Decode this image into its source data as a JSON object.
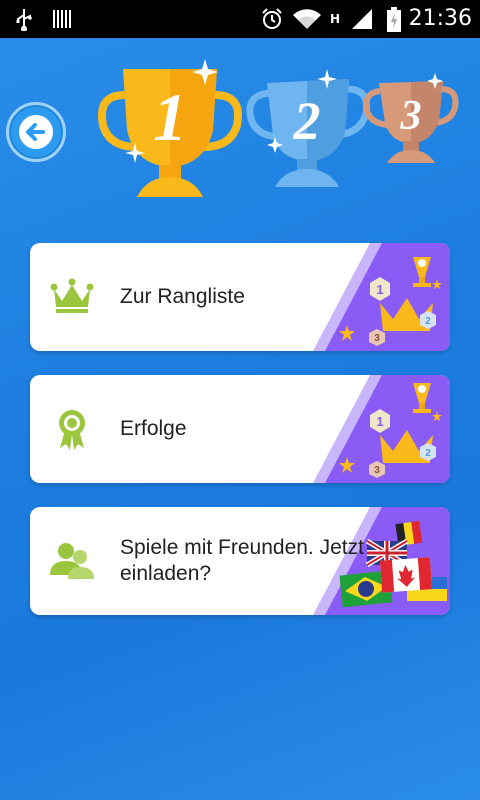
{
  "status_bar": {
    "time": "21:36",
    "network_label": "H",
    "icons": [
      "usb-icon",
      "barcode-icon",
      "alarm-icon",
      "wifi-icon",
      "signal-icon",
      "battery-icon"
    ]
  },
  "header": {
    "back_icon": "arrow-left-icon",
    "trophies": [
      "1",
      "2",
      "3"
    ]
  },
  "menu": {
    "items": [
      {
        "label": "Zur Rangliste",
        "icon": "crown-icon"
      },
      {
        "label": "Erfolge",
        "icon": "award-icon"
      },
      {
        "label_line1": "Spiele mit Freunden. Jetzt",
        "label_line2": "einladen?",
        "icon": "friends-icon"
      }
    ]
  },
  "colors": {
    "background": "#1e7fe0",
    "accent_green": "#9bc53d",
    "purple": "#8a5cf5",
    "gold": "#f9b91b",
    "silver_blue": "#6fb6f0",
    "bronze": "#d69a7a"
  }
}
